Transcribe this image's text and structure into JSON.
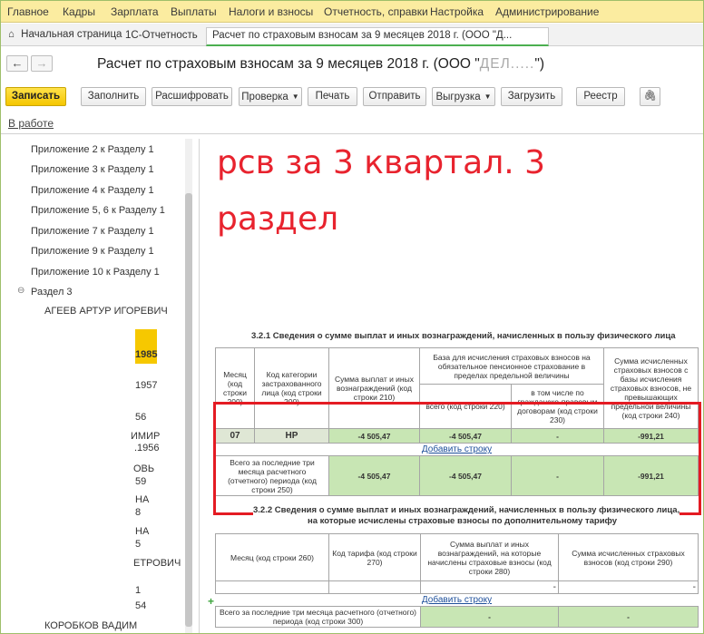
{
  "menu": [
    "Главное",
    "Кадры",
    "Зарплата",
    "Выплаты",
    "Налоги и взносы",
    "Отчетность, справки",
    "Настройка",
    "Администрирование"
  ],
  "tabs": {
    "home": "Начальная страница",
    "reporting": "1С-Отчетность",
    "report": "Расчет по страховым взносам за 9 месяцев 2018 г. (ООО \"Д..."
  },
  "title": {
    "main": "Расчет по страховым взносам за 9 месяцев 2018 г. (ООО \"",
    "company_blurred": "ДЕЛ.....",
    "tail": "\")"
  },
  "toolbar": [
    "Записать",
    "Заполнить",
    "Расшифровать",
    "Проверка",
    "Печать",
    "Отправить",
    "Выгрузка",
    "Загрузить",
    "Реестр"
  ],
  "status": "В работе",
  "tree": {
    "items": [
      "Приложение 2 к Разделу 1",
      "Приложение 3 к Разделу 1",
      "Приложение 4 к Разделу 1",
      "Приложение 5, 6 к Разделу 1",
      "Приложение 7 к Разделу 1",
      "Приложение 9 к Разделу 1",
      "Приложение 10 к Разделу 1"
    ],
    "section3": "Раздел 3",
    "persons": [
      "АГЕЕВ АРТУР ИГОРЕВИЧ",
      "1985",
      "1957",
      "56",
      "ИМИР",
      ".1956",
      "ОВЬ",
      "59",
      "НА",
      "8",
      "НА",
      "5",
      "ЕТРОВИЧ",
      "1",
      "54",
      "КОРОБКОВ ВАДИМ"
    ]
  },
  "caption": {
    "line1": "рсв за 3 квартал. 3",
    "line2": "раздел"
  },
  "section321": {
    "title": "3.2.1 Сведения о сумме выплат и иных вознаграждений, начисленных в пользу физического лица",
    "h_month": "Месяц (код строки 200)",
    "h_category": "Код категории застрахованного лица (код строки 200)",
    "h_sum": "Сумма выплат и иных вознаграждений (код строки 210)",
    "h_base": "База для исчисления страховых взносов на обязательное пенсионное страхование в пределах предельной величины",
    "h_base_all": "всего (код строки 220)",
    "h_base_civil": "в том числе по гражданско-правовым договорам (код строки 230)",
    "h_contrib": "Сумма исчисленных страховых взносов с базы исчисления страховых взносов, не превышающих предельной величины (код строки 240)",
    "row_month": "07",
    "row_category": "НР",
    "row_sum": "-4 505,47",
    "row_base": "-4 505,47",
    "row_civil": "-",
    "row_contrib": "-991,21",
    "add_row": "Добавить строку",
    "total_label": "Всего за последние три месяца расчетного (отчетного) периода (код строки 250)",
    "total_sum": "-4 505,47",
    "total_base": "-4 505,47",
    "total_civil": "-",
    "total_contrib": "-991,21"
  },
  "section322": {
    "title1": "3.2.2 Сведения о сумме выплат и иных вознаграждений, начисленных в пользу физического лица,",
    "title2": "на которые исчислены страховые взносы по дополнительному тарифу",
    "h_month": "Месяц (код строки 260)",
    "h_tariff": "Код тарифа (код строки 270)",
    "h_sum": "Сумма выплат и иных вознаграждений, на которые начислены страховые взносы (код строки 280)",
    "h_contrib": "Сумма исчисленных страховых взносов (код строки 290)",
    "dash": "-",
    "add_row": "Добавить строку",
    "total_label": "Всего за последние три месяца расчетного (отчетного) периода (код строки 300)"
  },
  "colors": {
    "menu_bg": "#fbeca0",
    "accent_green": "#4caf50",
    "primary_btn": "#f5c600",
    "red": "#e41b23",
    "cell_green": "#c8e6b4"
  }
}
